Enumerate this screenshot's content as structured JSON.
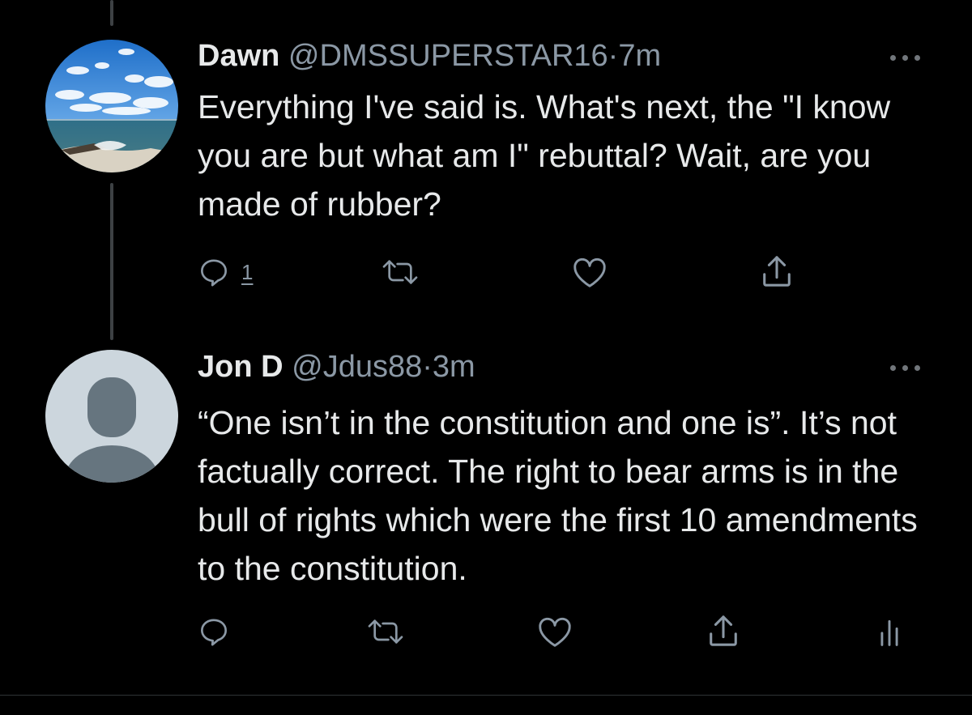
{
  "tweets": [
    {
      "name": "Dawn",
      "handle": "@DMSSUPERSTAR16",
      "time": "7m",
      "text": "Everything I've said is.  What's next, the \"I know you are but what am I\" rebuttal?  Wait, are you made of rubber?",
      "reply_count": "1",
      "avatar_icon": "beach-photo-avatar"
    },
    {
      "name": "Jon D",
      "handle": "@Jdus88",
      "time": "3m",
      "text": "“One isn’t in the constitution and one is”. It’s not factually correct. The right to bear arms is in the bull of rights which were the first 10 amendments to the constitution.",
      "reply_count": "",
      "avatar_icon": "default-profile-avatar"
    }
  ],
  "separator": "·",
  "icons": [
    "reply-icon",
    "retweet-icon",
    "like-icon",
    "share-icon",
    "analytics-icon",
    "more-icon"
  ],
  "colors": {
    "background": "#000000",
    "text": "#e7e9ea",
    "muted": "#8b98a5",
    "thread_line": "#3d4144"
  }
}
